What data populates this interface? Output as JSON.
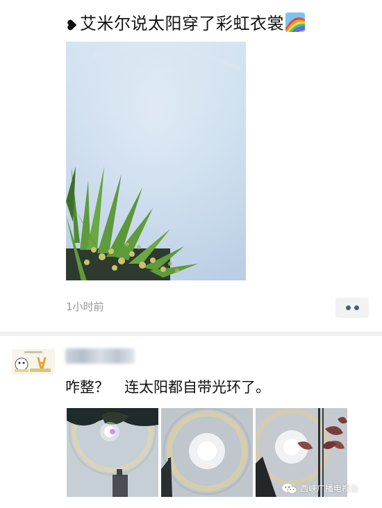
{
  "post": {
    "text": "艾米尔说太阳穿了彩虹衣裳",
    "heart_icon": "black-heart-icon",
    "emoji_icon": "rainbow-emoji-icon",
    "photo_description": "plant-under-hazy-sky-photo",
    "timestamp": "1小时前",
    "more_icon": "more-dots-icon"
  },
  "comment": {
    "avatar_icon": "cartoon-avatar-icon",
    "username": "",
    "text_part1": "咋整？",
    "text_part2": "连太阳都自带光环了。",
    "photos": [
      "sun-halo-photo-1",
      "sun-halo-photo-2",
      "sun-halo-photo-3"
    ]
  },
  "watermark": {
    "icon": "wechat-icon",
    "text": "西峡广播电视台"
  },
  "colors": {
    "text": "#111111",
    "timestamp": "#9a9a9a",
    "more_dots": "#4c5d7d",
    "divider": "#f0f0f0"
  }
}
